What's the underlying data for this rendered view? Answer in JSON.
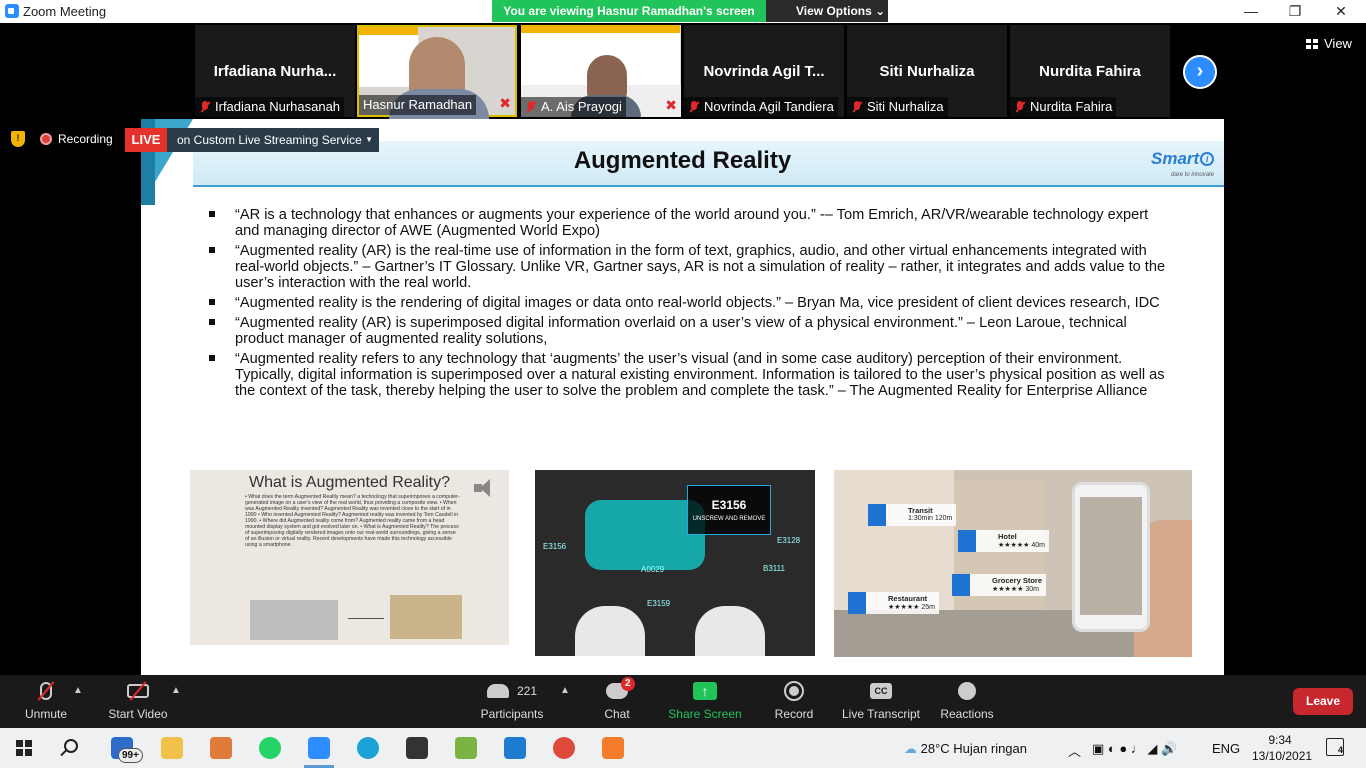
{
  "window": {
    "title": "Zoom Meeting",
    "banner": "You are viewing Hasnur Ramadhan's screen",
    "view_options": "View Options",
    "minimize": "—",
    "maximize": "❐",
    "close": "✕"
  },
  "gallery": {
    "participants": [
      {
        "display": "Irfadiana  Nurha...",
        "label": "Irfadiana Nurhasanah",
        "muted": true
      },
      {
        "display": "",
        "label": "Hasnur Ramadhan",
        "muted": false,
        "video": true
      },
      {
        "display": "",
        "label": "A. Ais Prayogi",
        "muted": true,
        "video": true
      },
      {
        "display": "Novrinda Agil T...",
        "label": "Novrinda Agil Tandiera",
        "muted": true
      },
      {
        "display": "Siti Nurhaliza",
        "label": "Siti Nurhaliza",
        "muted": true
      },
      {
        "display": "Nurdita Fahira",
        "label": "Nurdita Fahira",
        "muted": true
      }
    ],
    "view_label": "View"
  },
  "recording": {
    "label": "Recording",
    "live": "LIVE",
    "service": "on Custom Live Streaming Service"
  },
  "slide": {
    "title": "Augmented Reality",
    "logo": "Smart",
    "logo_tagline": "dare to innovate",
    "bullets": [
      "“AR is a technology that enhances or augments your experience of the world around you.” -– Tom Emrich, AR/VR/wearable technology expert and managing director of AWE (Augmented World Expo)",
      "“Augmented reality (AR) is the real-time use of information in the form of text, graphics, audio, and other virtual enhancements integrated with real-world objects.” – Gartner’s IT Glossary. Unlike VR, Gartner says, AR is not a simulation of reality – rather, it integrates and adds value to the user’s interaction with the real world.",
      "“Augmented reality is the rendering of digital images or data onto real-world objects.” – Bryan Ma, vice president of client devices research, IDC",
      "“Augmented reality (AR) is superimposed digital information overlaid on a user’s view of a physical environment.” – Leon Laroue, technical product manager of augmented reality solutions,",
      "“Augmented reality refers to any technology that ‘augments’ the user’s visual (and in some case auditory) perception of their environment. Typically, digital information is superimposed over a natural existing environment. Information is tailored to the user’s physical position as well as the context of the task, thereby helping the user to solve the problem and complete the task.” – The Augmented Reality for Enterprise Alliance"
    ],
    "pic1": {
      "title": "What is Augmented Reality?",
      "body": "• What does the term Augmented Reality mean? a technology that superimposes a computer-generated image on a user's view of the real world, thus providing a composite view. • When was Augmented Reality invented? Augmented Reality was invented close to the start of in 1990 • Who invented Augmented Reality? Augmented reality was invented by Tom Caudell in 1990. • Where did Augmented reality come from? Augmented reality came from a head mounted display system and got evolved later on. • What is Augmented Reality? The process of superimposing digitally rendered images onto our real-world surroundings, giving a sense of an illusion or virtual reality. Recent developments have made this technology accessible using a smartphone."
    },
    "pic2": {
      "code": "E3156",
      "subtitle": "UNSCREW AND REMOVE",
      "labels": [
        "E3156",
        "A0029",
        "E3159",
        "E3128",
        "B3111"
      ]
    },
    "pic3": {
      "cards": [
        {
          "title": "Transit",
          "sub": "1:30min   120m"
        },
        {
          "title": "Hotel",
          "sub": "★★★★★   40m"
        },
        {
          "title": "Grocery Store",
          "sub": "★★★★★   30m"
        },
        {
          "title": "Restaurant",
          "sub": "★★★★★   25m"
        }
      ]
    }
  },
  "controls": {
    "unmute": "Unmute",
    "start_video": "Start Video",
    "participants": "Participants",
    "participants_count": "221",
    "chat": "Chat",
    "chat_badge": "2",
    "share_screen": "Share Screen",
    "record": "Record",
    "live_transcript": "Live Transcript",
    "cc": "CC",
    "reactions": "Reactions",
    "leave": "Leave"
  },
  "taskbar": {
    "mail_badge": "99+",
    "weather": "28°C  Hujan ringan",
    "language": "ENG",
    "time": "9:34",
    "date": "13/10/2021",
    "notifications": "4"
  }
}
